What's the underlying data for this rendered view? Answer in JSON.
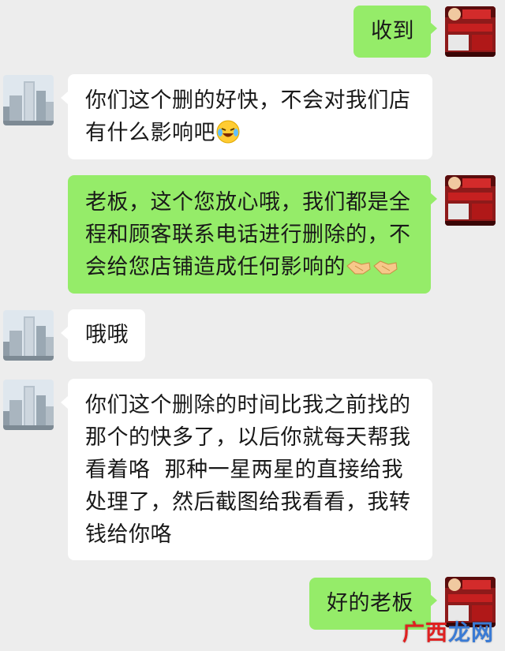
{
  "messages": [
    {
      "id": "m1",
      "side": "right",
      "lines": [
        "收到"
      ]
    },
    {
      "id": "m2",
      "side": "left",
      "lines": [
        "你们这个删的好快，不会对我们店",
        "有什么影响吧"
      ],
      "emoji": "laughing-tears-icon"
    },
    {
      "id": "m3",
      "side": "right",
      "lines": [
        "老板，这个您放心哦，我们都是全",
        "程和顾客联系电话进行删除的，不",
        "会给您店铺造成任何影响的"
      ],
      "emoji": "handshake-icon"
    },
    {
      "id": "m4",
      "side": "left",
      "lines": [
        "哦哦"
      ]
    },
    {
      "id": "m5",
      "side": "left",
      "lines": [
        "你们这个删除的时间比我之前找的",
        "那个的快多了，以后你就每天帮我",
        "看着咯  那种一星两星的直接给我",
        "处理了，然后截图给我看看，我转",
        "钱给你咯"
      ]
    },
    {
      "id": "m6",
      "side": "right",
      "lines": [
        "好的老板"
      ]
    }
  ],
  "watermark": {
    "part1": "广",
    "part2": "西",
    "part3": "龙网"
  },
  "colors": {
    "my_bubble": "#95ec69",
    "other_bubble": "#ffffff",
    "background": "#ededed"
  }
}
